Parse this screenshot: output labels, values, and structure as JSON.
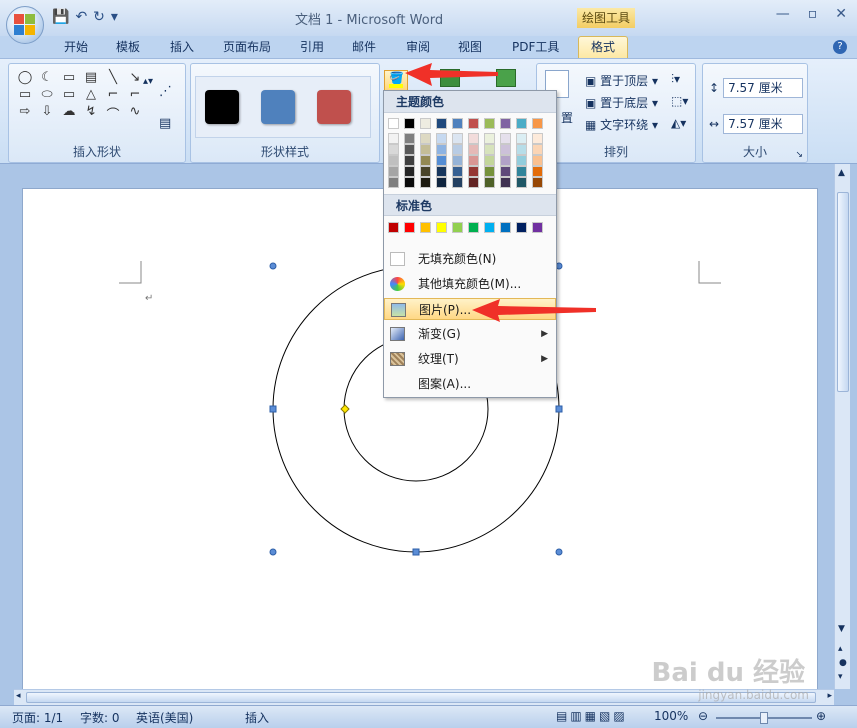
{
  "window": {
    "title": "文档 1 - Microsoft Word",
    "context_tab_header": "绘图工具",
    "minimize": "—",
    "restore": "▫",
    "close": "✕"
  },
  "qat": {
    "save_icon": "save-icon",
    "undo_icon": "undo-icon",
    "redo_icon": "redo-icon"
  },
  "tabs": [
    "开始",
    "模板",
    "插入",
    "页面布局",
    "引用",
    "邮件",
    "审阅",
    "视图",
    "PDF工具",
    "格式"
  ],
  "active_tab": "格式",
  "ribbon": {
    "groups": {
      "insert_shapes": "插入形状",
      "shape_styles": "形状样式",
      "arrange": "排列",
      "size": "大小"
    },
    "shape_glyphs": [
      "◯",
      "☾",
      "▭",
      "▤",
      "╲",
      "↘",
      "▭",
      "⬭",
      "▭",
      "△",
      "⌐",
      "⌐",
      "⇨",
      "⇩",
      "☁",
      "↯",
      "⌒",
      "∿"
    ],
    "style_colors": [
      "#000000",
      "#4f81bd",
      "#c0504d"
    ],
    "arrange_items": [
      "置于顶层",
      "置于底层",
      "文字环绕"
    ],
    "partial_arrange_label": "置",
    "height_value": "7.57 厘米",
    "width_value": "7.57 厘米"
  },
  "fill_menu": {
    "theme_header": "主题颜色",
    "standard_header": "标准色",
    "theme_top": [
      "#ffffff",
      "#000000",
      "#eeece1",
      "#1f497d",
      "#4f81bd",
      "#c0504d",
      "#9bbb59",
      "#8064a2",
      "#4bacc6",
      "#f79646"
    ],
    "theme_shades": [
      [
        "#f2f2f2",
        "#7f7f7f",
        "#ddd9c3",
        "#c6d9f0",
        "#dbe5f1",
        "#f2dcdb",
        "#ebf1dd",
        "#e5e0ec",
        "#dbeef3",
        "#fdeada"
      ],
      [
        "#d8d8d8",
        "#595959",
        "#c4bd97",
        "#8db3e2",
        "#b8cce4",
        "#e5b9b7",
        "#d7e3bc",
        "#ccc1d9",
        "#b7dde8",
        "#fbd5b5"
      ],
      [
        "#bfbfbf",
        "#3f3f3f",
        "#938953",
        "#548dd4",
        "#95b3d7",
        "#d99694",
        "#c3d69b",
        "#b2a2c7",
        "#92cddc",
        "#fac08f"
      ],
      [
        "#a5a5a5",
        "#262626",
        "#494429",
        "#17365d",
        "#366092",
        "#953734",
        "#76923c",
        "#5f497a",
        "#31859b",
        "#e36c09"
      ],
      [
        "#7f7f7f",
        "#0c0c0c",
        "#1d1b10",
        "#0f243e",
        "#244061",
        "#632423",
        "#4f6128",
        "#3f3151",
        "#205867",
        "#974806"
      ]
    ],
    "standard": [
      "#c00000",
      "#ff0000",
      "#ffc000",
      "#ffff00",
      "#92d050",
      "#00b050",
      "#00b0f0",
      "#0070c0",
      "#002060",
      "#7030a0"
    ],
    "items": [
      {
        "label": "无填充颜色(N)",
        "icon": "no-fill-icon"
      },
      {
        "label": "其他填充颜色(M)...",
        "icon": "palette-icon"
      },
      {
        "label": "图片(P)...",
        "icon": "picture-icon"
      },
      {
        "label": "渐变(G)",
        "icon": "gradient-icon",
        "submenu": true
      },
      {
        "label": "纹理(T)",
        "icon": "texture-icon",
        "submenu": true
      },
      {
        "label": "图案(A)...",
        "icon": "pattern-icon"
      }
    ]
  },
  "status": {
    "page": "页面: 1/1",
    "words": "字数: 0",
    "language": "英语(美国)",
    "mode": "插入",
    "zoom": "100%"
  },
  "watermark": {
    "main": "Bai du 经验",
    "sub": "jingyan.baidu.com"
  }
}
